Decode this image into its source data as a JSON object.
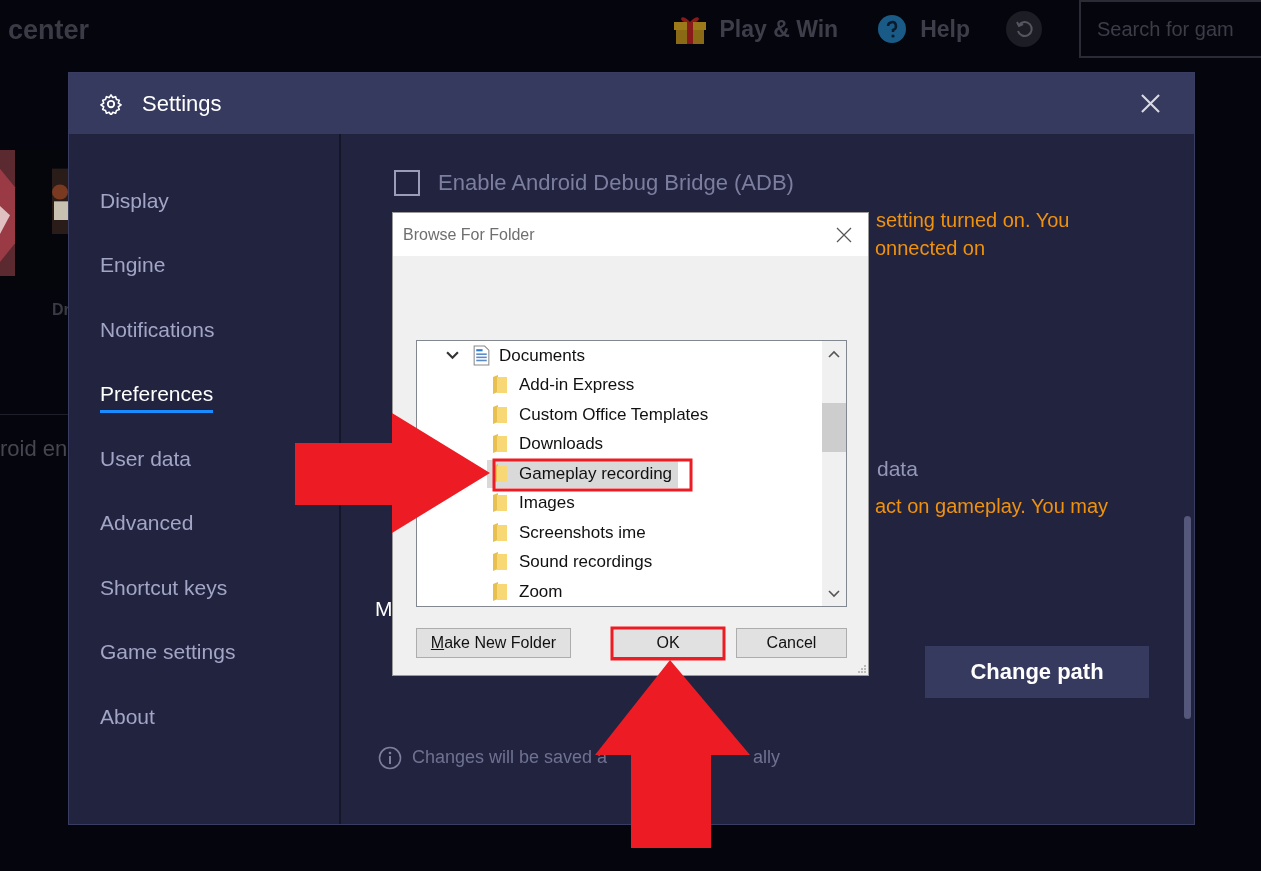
{
  "top_bar": {
    "brand_fragment": "center",
    "play_and_win": "Play & Win",
    "help": "Help",
    "search": {
      "placeholder": "Search for gam"
    }
  },
  "background": {
    "game_label_fragment": "Dr",
    "text_fragment": "roid en"
  },
  "settings": {
    "title": "Settings",
    "sidebar": [
      {
        "label": "Display",
        "selected": false
      },
      {
        "label": "Engine",
        "selected": false
      },
      {
        "label": "Notifications",
        "selected": false
      },
      {
        "label": "Preferences",
        "selected": true
      },
      {
        "label": "User data",
        "selected": false
      },
      {
        "label": "Advanced",
        "selected": false
      },
      {
        "label": "Shortcut keys",
        "selected": false
      },
      {
        "label": "Game settings",
        "selected": false
      },
      {
        "label": "About",
        "selected": false
      }
    ],
    "adb": {
      "label": "Enable Android Debug Bridge (ADB)",
      "checked": false
    },
    "fragments": [
      {
        "text": "setting turned on. You",
        "kind": "warning"
      },
      {
        "text": "onnected on",
        "kind": "warning"
      },
      {
        "text": "data",
        "kind": "title"
      },
      {
        "text": "act on gameplay. You may",
        "kind": "warning"
      },
      {
        "text": "M",
        "kind": "heading"
      }
    ],
    "change_path": "Change path",
    "footer_note": [
      "Changes will be saved a",
      "ally"
    ]
  },
  "dialog": {
    "title": "Browse For Folder",
    "tree": [
      {
        "label": "Documents",
        "expanded": true,
        "children": [
          {
            "label": "Add-in Express",
            "selected": false
          },
          {
            "label": "Custom Office Templates",
            "selected": false
          },
          {
            "label": "Downloads",
            "selected": false
          },
          {
            "label": "Gameplay recording",
            "selected": true
          },
          {
            "label": "Images",
            "selected": false
          },
          {
            "label": "Screenshots ime",
            "selected": false
          },
          {
            "label": "Sound recordings",
            "selected": false
          },
          {
            "label": "Zoom",
            "selected": false
          }
        ]
      }
    ],
    "buttons": [
      {
        "label": "Make New Folder",
        "kind": "plain",
        "access_key_underlined": true
      },
      {
        "label": "OK",
        "kind": "default"
      },
      {
        "label": "Cancel",
        "kind": "plain"
      }
    ]
  }
}
